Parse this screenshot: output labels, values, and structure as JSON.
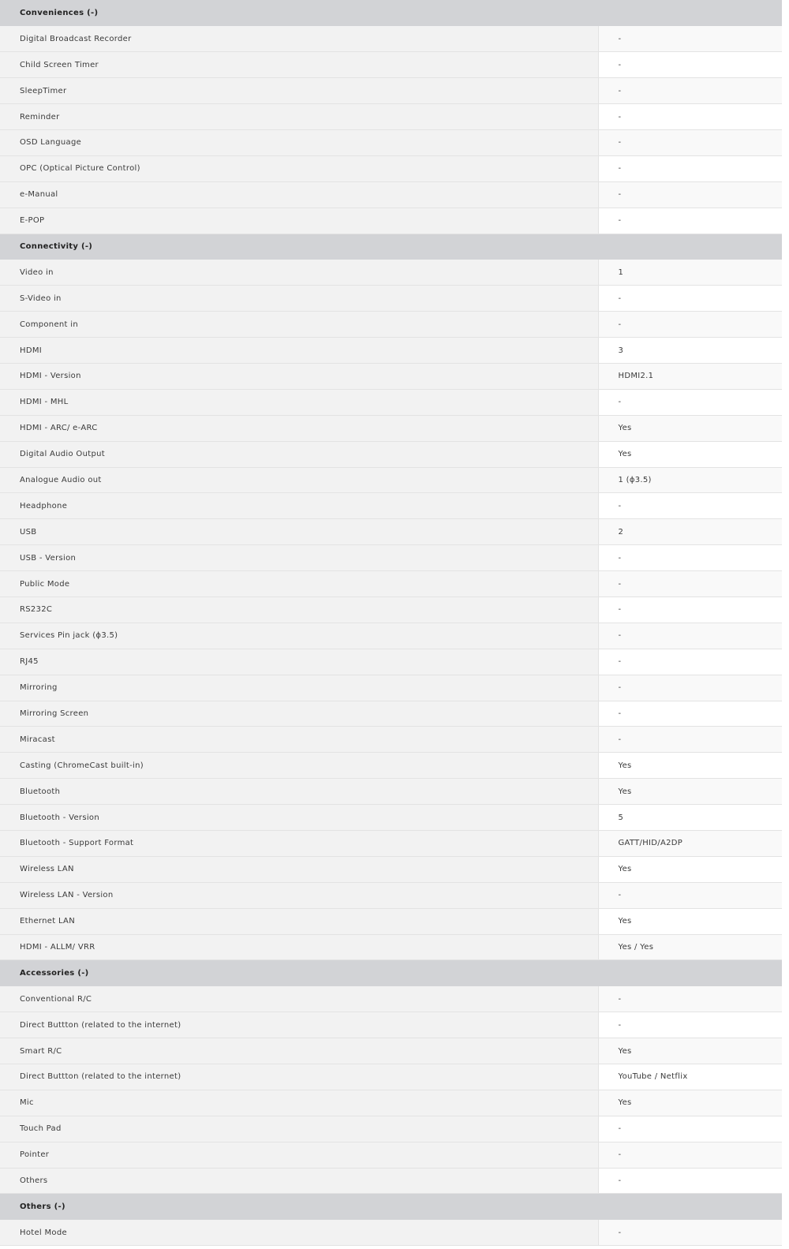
{
  "sections": [
    {
      "title": "Conveniences (-)",
      "rows": [
        {
          "label": "Digital Broadcast Recorder",
          "value": "-"
        },
        {
          "label": "Child Screen Timer",
          "value": "-"
        },
        {
          "label": "SleepTimer",
          "value": "-"
        },
        {
          "label": "Reminder",
          "value": "-"
        },
        {
          "label": "OSD Language",
          "value": "-"
        },
        {
          "label": "OPC (Optical Picture Control)",
          "value": "-"
        },
        {
          "label": "e-Manual",
          "value": "-"
        },
        {
          "label": "E-POP",
          "value": "-"
        }
      ]
    },
    {
      "title": "Connectivity (-)",
      "rows": [
        {
          "label": "Video in",
          "value": "1"
        },
        {
          "label": "S-Video in",
          "value": "-"
        },
        {
          "label": "Component in",
          "value": "-"
        },
        {
          "label": "HDMI",
          "value": "3"
        },
        {
          "label": "HDMI - Version",
          "value": "HDMI2.1"
        },
        {
          "label": "HDMI - MHL",
          "value": "-"
        },
        {
          "label": "HDMI - ARC/ e-ARC",
          "value": "Yes"
        },
        {
          "label": "Digital Audio Output",
          "value": "Yes"
        },
        {
          "label": "Analogue Audio out",
          "value": "1 (ϕ3.5)"
        },
        {
          "label": "Headphone",
          "value": "-"
        },
        {
          "label": "USB",
          "value": "2"
        },
        {
          "label": "USB - Version",
          "value": "-"
        },
        {
          "label": "Public Mode",
          "value": "-"
        },
        {
          "label": "RS232C",
          "value": "-"
        },
        {
          "label": "Services Pin jack (ϕ3.5)",
          "value": "-"
        },
        {
          "label": "RJ45",
          "value": "-"
        },
        {
          "label": "Mirroring",
          "value": "-"
        },
        {
          "label": "Mirroring Screen",
          "value": "-"
        },
        {
          "label": "Miracast",
          "value": "-"
        },
        {
          "label": "Casting (ChromeCast built-in)",
          "value": "Yes"
        },
        {
          "label": "Bluetooth",
          "value": "Yes"
        },
        {
          "label": "Bluetooth - Version",
          "value": "5"
        },
        {
          "label": "Bluetooth - Support Format",
          "value": "GATT/HID/A2DP"
        },
        {
          "label": "Wireless LAN",
          "value": "Yes"
        },
        {
          "label": "Wireless LAN - Version",
          "value": "-"
        },
        {
          "label": "Ethernet LAN",
          "value": "Yes"
        },
        {
          "label": "HDMI - ALLM/ VRR",
          "value": "Yes / Yes"
        }
      ]
    },
    {
      "title": "Accessories (-)",
      "rows": [
        {
          "label": "Conventional R/C",
          "value": "-"
        },
        {
          "label": "Direct Buttton (related to the internet)",
          "value": "-"
        },
        {
          "label": "Smart R/C",
          "value": "Yes"
        },
        {
          "label": "Direct Buttton (related to the internet)",
          "value": "YouTube / Netflix"
        },
        {
          "label": "Mic",
          "value": "Yes"
        },
        {
          "label": "Touch Pad",
          "value": "-"
        },
        {
          "label": "Pointer",
          "value": "-"
        },
        {
          "label": "Others",
          "value": "-"
        }
      ]
    },
    {
      "title": "Others (-)",
      "rows": [
        {
          "label": "Hotel Mode",
          "value": "-"
        }
      ]
    }
  ],
  "colors": {
    "section_header_bg": "#d2d3d6",
    "label_cell_bg": "#f2f2f2",
    "value_cell_bg": "#ffffff",
    "value_cell_alt_bg": "#f9f9f9",
    "divider": "#e3e3e3"
  }
}
